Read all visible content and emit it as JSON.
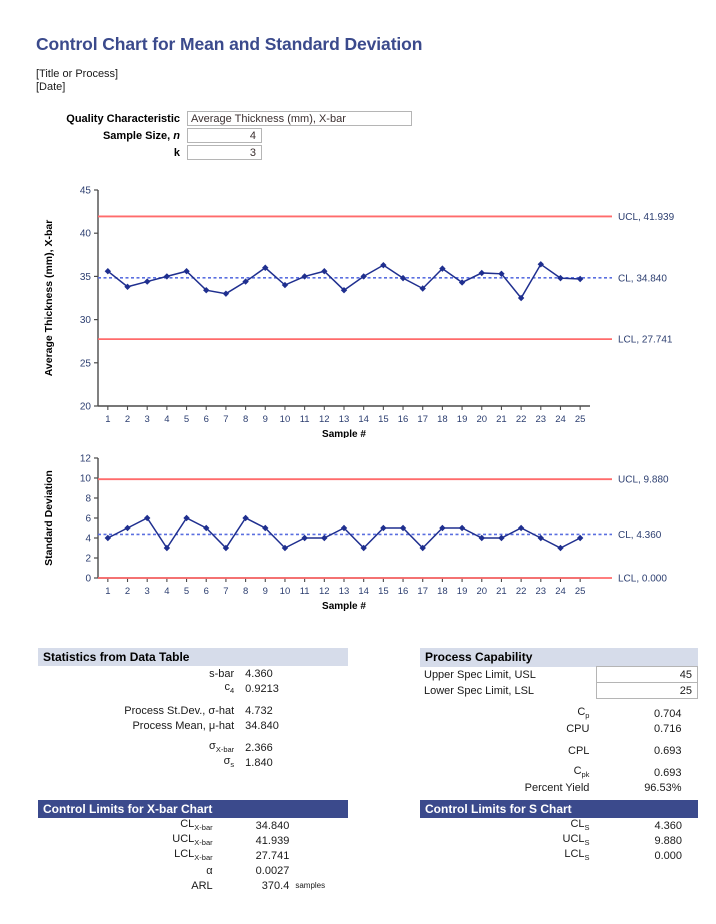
{
  "header": {
    "title": "Control Chart for Mean and Standard Deviation",
    "subtitle_line1": "[Title or Process]",
    "subtitle_line2": "[Date]"
  },
  "form": {
    "quality_characteristic_label": "Quality Characteristic",
    "quality_characteristic_value": "Average Thickness (mm), X-bar",
    "sample_size_label": "Sample Size, ",
    "sample_size_symbol": "n",
    "sample_size_value": "4",
    "k_symbol": "k",
    "k_value": "3"
  },
  "colors": {
    "title_blue": "#3b4a8c",
    "series_blue": "#1f2f8f",
    "center_line_blue": "#5a6fe0",
    "limit_red": "#ff6b6b",
    "header_light": "#d6dcea",
    "header_dark": "#3b4a8c",
    "axis_black": "#4a4a4a"
  },
  "chart_data": [
    {
      "type": "line",
      "name": "xbar-chart",
      "title": "",
      "xlabel": "Sample #",
      "ylabel": "Average Thickness (mm), X-bar",
      "ylim": [
        20,
        45
      ],
      "yticks": [
        20,
        25,
        30,
        35,
        40,
        45
      ],
      "xlim": [
        0.5,
        25.5
      ],
      "categories": [
        1,
        2,
        3,
        4,
        5,
        6,
        7,
        8,
        9,
        10,
        11,
        12,
        13,
        14,
        15,
        16,
        17,
        18,
        19,
        20,
        21,
        22,
        23,
        24,
        25
      ],
      "values": [
        35.6,
        33.8,
        34.4,
        35.0,
        35.6,
        33.4,
        33.0,
        34.4,
        36.0,
        34.0,
        35.0,
        35.6,
        33.4,
        35.0,
        36.3,
        34.8,
        33.6,
        35.9,
        34.3,
        35.4,
        35.3,
        32.5,
        36.4,
        34.8,
        34.7
      ],
      "grid": false,
      "reference_lines": [
        {
          "name": "UCL",
          "label": "UCL, 41.939",
          "value": 41.939,
          "color": "#ff6b6b",
          "style": "solid"
        },
        {
          "name": "CL",
          "label": "CL, 34.840",
          "value": 34.84,
          "color": "#5a6fe0",
          "style": "dashed"
        },
        {
          "name": "LCL",
          "label": "LCL, 27.741",
          "value": 27.741,
          "color": "#ff6b6b",
          "style": "solid"
        }
      ]
    },
    {
      "type": "line",
      "name": "s-chart",
      "title": "",
      "xlabel": "Sample #",
      "ylabel": "Standard Deviation",
      "ylim": [
        0,
        12
      ],
      "yticks": [
        0,
        2,
        4,
        6,
        8,
        10,
        12
      ],
      "xlim": [
        0.5,
        25.5
      ],
      "categories": [
        1,
        2,
        3,
        4,
        5,
        6,
        7,
        8,
        9,
        10,
        11,
        12,
        13,
        14,
        15,
        16,
        17,
        18,
        19,
        20,
        21,
        22,
        23,
        24,
        25
      ],
      "values": [
        4,
        5,
        6,
        3,
        6,
        5,
        3,
        6,
        5,
        3,
        4,
        4,
        5,
        3,
        5,
        5,
        3,
        5,
        5,
        4,
        4,
        5,
        4,
        3,
        4
      ],
      "grid": false,
      "reference_lines": [
        {
          "name": "UCL",
          "label": "UCL, 9.880",
          "value": 9.88,
          "color": "#ff6b6b",
          "style": "solid"
        },
        {
          "name": "CL",
          "label": "CL, 4.360",
          "value": 4.36,
          "color": "#5a6fe0",
          "style": "dashed"
        },
        {
          "name": "LCL",
          "label": "LCL, 0.000",
          "value": 0.0,
          "color": "#ff6b6b",
          "style": "solid"
        }
      ]
    }
  ],
  "stats_table": {
    "header": "Statistics from Data Table",
    "rows": [
      {
        "label": "s-bar",
        "value": "4.360"
      },
      {
        "label": "c",
        "sub": "4",
        "value": "0.9213"
      },
      {
        "label": "Process St.Dev., σ-hat",
        "value": "4.732"
      },
      {
        "label": "Process Mean, μ-hat",
        "value": "34.840"
      },
      {
        "label": "σ",
        "sub": "X-bar",
        "value": "2.366"
      },
      {
        "label": "σ",
        "sub": "s",
        "value": "1.840"
      }
    ]
  },
  "capability_table": {
    "header": "Process Capability",
    "usl_label": "Upper Spec Limit, USL",
    "usl_value": "45",
    "lsl_label": "Lower Spec Limit, LSL",
    "lsl_value": "25",
    "rows": [
      {
        "label": "C",
        "sub": "p",
        "value": "0.704"
      },
      {
        "label": "CPU",
        "sub": "",
        "value": "0.716"
      },
      {
        "label": "CPL",
        "sub": "",
        "value": "0.693"
      },
      {
        "label": "C",
        "sub": "pk",
        "value": "0.693"
      },
      {
        "label": "Percent Yield",
        "sub": "",
        "value": "96.53%"
      }
    ]
  },
  "xbar_limits_table": {
    "header": "Control Limits for X-bar Chart",
    "rows": [
      {
        "label": "CL",
        "sub": "X-bar",
        "value": "34.840",
        "unit": ""
      },
      {
        "label": "UCL",
        "sub": "X-bar",
        "value": "41.939",
        "unit": ""
      },
      {
        "label": "LCL",
        "sub": "X-bar",
        "value": "27.741",
        "unit": ""
      },
      {
        "label": "α",
        "sub": "",
        "value": "0.0027",
        "unit": ""
      },
      {
        "label": "ARL",
        "sub": "",
        "value": "370.4",
        "unit": "samples"
      }
    ]
  },
  "s_limits_table": {
    "header": "Control Limits for S Chart",
    "rows": [
      {
        "label": "CL",
        "sub": "S",
        "value": "4.360"
      },
      {
        "label": "UCL",
        "sub": "S",
        "value": "9.880"
      },
      {
        "label": "LCL",
        "sub": "S",
        "value": "0.000"
      }
    ]
  }
}
